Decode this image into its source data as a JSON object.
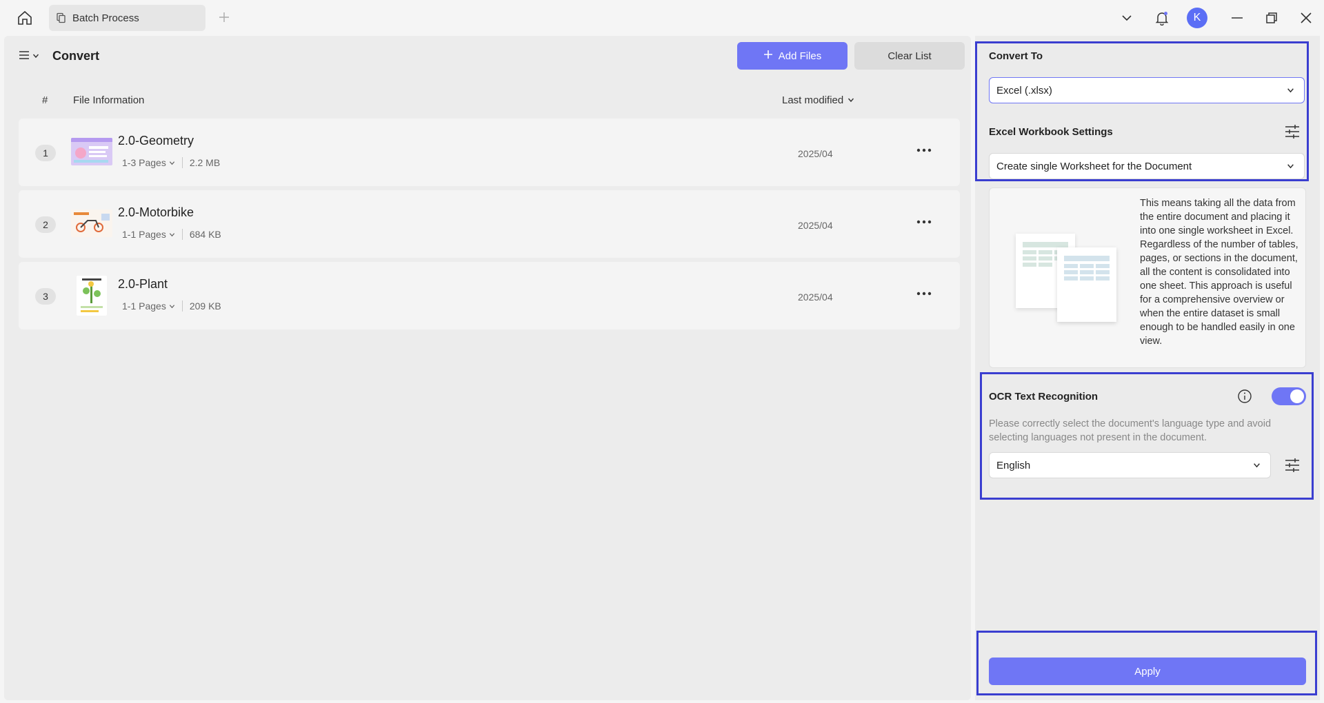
{
  "titlebar": {
    "tab_label": "Batch Process",
    "avatar_initial": "K"
  },
  "header": {
    "title": "Convert",
    "add_files_label": "Add Files",
    "clear_list_label": "Clear List"
  },
  "table": {
    "col_number": "#",
    "col_info": "File Information",
    "col_modified": "Last modified"
  },
  "files": [
    {
      "index": "1",
      "name": "2.0-Geometry",
      "pages": "1-3 Pages",
      "size": "2.2 MB",
      "date": "2025/04"
    },
    {
      "index": "2",
      "name": "2.0-Motorbike",
      "pages": "1-1 Pages",
      "size": "684 KB",
      "date": "2025/04"
    },
    {
      "index": "3",
      "name": "2.0-Plant",
      "pages": "1-1 Pages",
      "size": "209 KB",
      "date": "2025/04"
    }
  ],
  "settings": {
    "convert_to_title": "Convert To",
    "convert_to_value": "Excel (.xlsx)",
    "workbook_title": "Excel Workbook Settings",
    "workbook_value": "Create single Worksheet for the Document",
    "description": "This means taking all the data from the entire document and placing it into one single worksheet in Excel. Regardless of the number of tables, pages, or sections in the document, all the content is consolidated into one sheet. This approach is useful for a comprehensive overview or when the entire dataset is small enough to be handled easily in one view.",
    "ocr_title": "OCR Text Recognition",
    "ocr_enabled": true,
    "ocr_description": "Please correctly select the document's language type and avoid selecting languages not present in the document.",
    "language_value": "English",
    "apply_label": "Apply"
  },
  "colors": {
    "accent": "#6f76f5",
    "highlight_border": "#3a3ed0"
  },
  "icons": [
    "home-icon",
    "tab-doc-icon",
    "plus-icon",
    "chevron-down-icon",
    "bell-icon",
    "minimize-icon",
    "restore-icon",
    "close-icon",
    "menu-icon",
    "more-icon",
    "info-icon",
    "tune-icon"
  ]
}
